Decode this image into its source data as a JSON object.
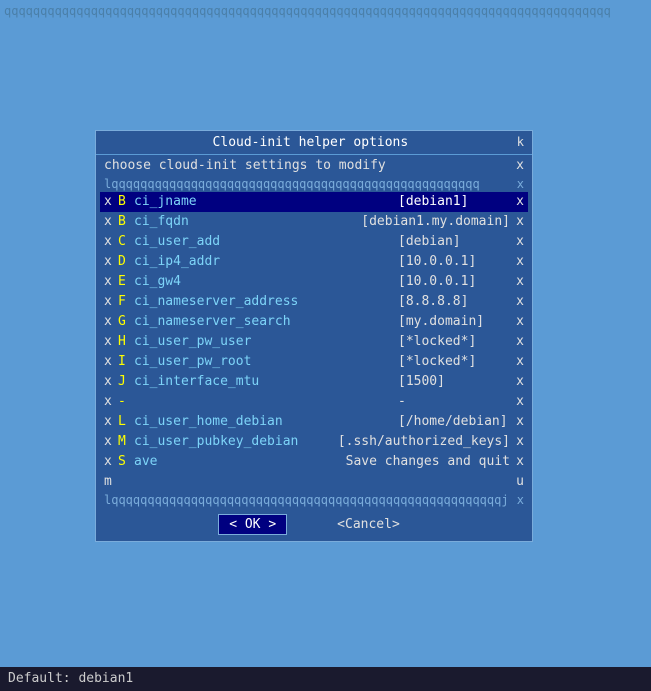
{
  "topBar": {
    "text": "qqqqqqqqqqqqqqqqqqqqqqqqqqqqqqqqqqqqqqqqqqqqqqqqqqqqqqqqqqqqqqqqqqqqqqqqqqqqqqqqqqqq"
  },
  "dialog": {
    "title": "Cloud-init helper options",
    "subtitle": "choose cloud-init settings to modify",
    "borderRow": "lqqqqqqqqqqqqqqqqqqqqqqqqqqqqqqqqqqqqqqqqqqqqqqqqqqq",
    "items": [
      {
        "x": "x",
        "letter": "B",
        "key": "ci_jname",
        "value": "[debian1]",
        "selected": true
      },
      {
        "x": "x",
        "letter": "B",
        "key": "ci_fqdn",
        "value": "[debian1.my.domain]",
        "selected": false
      },
      {
        "x": "x",
        "letter": "C",
        "key": "ci_user_add",
        "value": "[debian]",
        "selected": false
      },
      {
        "x": "x",
        "letter": "D",
        "key": "ci_ip4_addr",
        "value": "[10.0.0.1]",
        "selected": false
      },
      {
        "x": "x",
        "letter": "E",
        "key": "ci_gw4",
        "value": "[10.0.0.1]",
        "selected": false
      },
      {
        "x": "x",
        "letter": "F",
        "key": "ci_nameserver_address",
        "value": "[8.8.8.8]",
        "selected": false
      },
      {
        "x": "x",
        "letter": "G",
        "key": "ci_nameserver_search",
        "value": "[my.domain]",
        "selected": false
      },
      {
        "x": "x",
        "letter": "H",
        "key": "ci_user_pw_user",
        "value": "[*locked*]",
        "selected": false
      },
      {
        "x": "x",
        "letter": "I",
        "key": "ci_user_pw_root",
        "value": "[*locked*]",
        "selected": false
      },
      {
        "x": "x",
        "letter": "J",
        "key": "ci_interface_mtu",
        "value": "[1500]",
        "selected": false
      },
      {
        "x": "x",
        "letter": "-",
        "key": "",
        "value": "-",
        "selected": false
      },
      {
        "x": "x",
        "letter": "L",
        "key": "ci_user_home_debian",
        "value": "[/home/debian]",
        "selected": false
      },
      {
        "x": "x",
        "letter": "M",
        "key": "ci_user_pubkey_debian",
        "value": "[.ssh/authorized_keys]",
        "selected": false
      },
      {
        "x": "x",
        "letter": "S",
        "key": "ave",
        "value": "Save changes and quit",
        "selected": false
      }
    ],
    "rowM": "m",
    "buttons": {
      "ok": "< OK >",
      "cancel": "<Cancel>"
    }
  },
  "bottomBar": {
    "text": "Default: debian1"
  }
}
